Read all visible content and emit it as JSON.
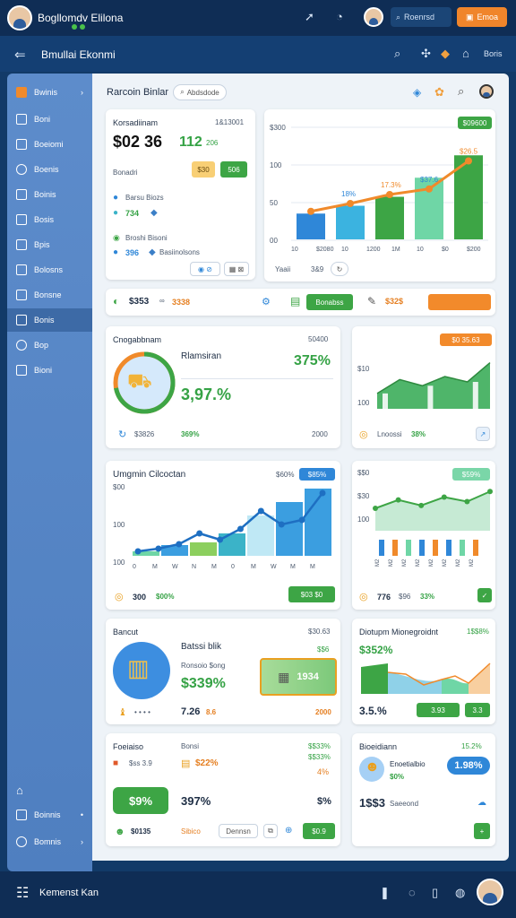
{
  "topbar": {
    "title": "Bogllomdv Elilona",
    "search_label": "Roenrsd",
    "orange_label": "Emoa"
  },
  "subbar": {
    "title": "Bmullai Ekonmi",
    "right_label": "Boris"
  },
  "sidebar": {
    "items": [
      {
        "label": "Bwinis"
      },
      {
        "label": "Boni"
      },
      {
        "label": "Boeiomi"
      },
      {
        "label": "Boenis"
      },
      {
        "label": "Boinis"
      },
      {
        "label": "Bosis"
      },
      {
        "label": "Bpis"
      },
      {
        "label": "Bolosns"
      },
      {
        "label": "Bonsne"
      },
      {
        "label": "Bonis"
      },
      {
        "label": "Bop"
      },
      {
        "label": "Bioni"
      }
    ],
    "bottom_items": [
      {
        "label": "Boinnis"
      },
      {
        "label": "Bomnis"
      }
    ]
  },
  "header": {
    "title": "Rarcoin Binlar",
    "chip": "Abdsdode"
  },
  "summary": {
    "title": "Korsadiinam",
    "right": "1&13001",
    "value1": "$02 36",
    "value2": "112",
    "value2_suffix": "206",
    "row_label": "Bonadri",
    "chip_orange": "$30",
    "btn_green": "506",
    "item1_label": "Barsu Biozs",
    "item1_val": "734",
    "item2_label": "Broshi Bisoni",
    "item3_val": "396",
    "item3_label": "Basiinolsons"
  },
  "main_chart": {
    "x_caption": "Yaaii",
    "x_caption2": "3&9",
    "points": [
      "18%",
      "17.3%",
      "$37.6",
      "$26.5"
    ],
    "right_label": "1700",
    "badge": "$09600"
  },
  "chart_data": [
    {
      "type": "bar",
      "title": "",
      "categories": [
        "1",
        "2",
        "3",
        "4",
        "5"
      ],
      "values": [
        23,
        30,
        38,
        55,
        75
      ],
      "line_values": [
        25,
        32,
        40,
        45,
        70
      ],
      "yticks": [
        "$300",
        "100",
        "50",
        "00"
      ],
      "xticks": [
        "10",
        "$2080",
        "10",
        "1200",
        "1M",
        "10",
        "$0",
        "$200"
      ],
      "ylim": [
        0,
        100
      ]
    },
    {
      "type": "area",
      "title": "",
      "values": [
        20,
        38,
        30,
        42,
        35,
        60
      ],
      "yticks": [
        "$10",
        "100",
        "$30"
      ]
    },
    {
      "type": "line",
      "title": "Umgmin Cilcoctan",
      "categories": [
        "0",
        "M",
        "W",
        "N",
        "M",
        "0",
        "M",
        "W",
        "M",
        "M"
      ],
      "values": [
        5,
        8,
        13,
        25,
        18,
        30,
        50,
        35,
        40,
        70
      ],
      "bar_values": [
        5,
        12,
        15,
        25,
        45,
        60,
        75
      ],
      "yticks": [
        "$00",
        "100",
        "100"
      ],
      "annotation": "$60%",
      "badge": "$85%"
    },
    {
      "type": "area",
      "title": "",
      "values": [
        40,
        55,
        45,
        60,
        52,
        70
      ],
      "yticks": [
        "$$0",
        "$30",
        "100"
      ],
      "badge": "$59%"
    }
  ],
  "action_bar": {
    "value": "$353",
    "chg": "3338",
    "btn_green": "Bonabss",
    "val2": "$32$",
    "btn_orange": ""
  },
  "progress_card": {
    "title": "Cnogabbnam",
    "right": "50400",
    "progress": 0.72,
    "name": "Rlamsiran",
    "pct": "375%",
    "value": "3,97.%",
    "footer1": "$3826",
    "footer2": "369%",
    "footer3": "2000"
  },
  "mini_card": {
    "badge": "$0 35.63",
    "footer1": "Lnoossi",
    "footer2": "38%"
  },
  "line_card": {
    "footer1": "300",
    "footer2": "$00%",
    "btn": "$03 $0"
  },
  "right_chart2": {
    "footer1": "776",
    "footer2": "$96",
    "footer3": "33%"
  },
  "bank_card": {
    "title": "Bancut",
    "right": "$30.63",
    "name": "Batssi blik",
    "sub": "Ronsoio $ong",
    "pct": "$339%",
    "highlight": "1934",
    "val1": "7.26",
    "val2": "8.6",
    "right_val": "$$6",
    "right_val2": "2000"
  },
  "mgmt_card": {
    "title": "Diotupm Mionegroidnt",
    "right": "1$$8%",
    "pct": "$352%",
    "value": "3.5.%",
    "btn1": "3.93",
    "btn2": "3.3"
  },
  "fin_card": {
    "title": "Foeiaiso",
    "title2": "Bonsi",
    "right": "$$33%",
    "r1": "$ss 3.9",
    "r1b": "$$33%",
    "r2": "$22%",
    "r2b": "4%",
    "btn": "$9%",
    "v1": "397%",
    "v2": "$%",
    "f1": "$0135",
    "f2": "Sibico",
    "f3": "Dennsn",
    "btn2": "$0.9"
  },
  "user_card": {
    "title": "Bioeidiann",
    "right": "15.2%",
    "name": "Enoetialbio",
    "pct": "$0%",
    "btn": "1.98%",
    "value": "1$$3",
    "sub": "Saeeond"
  },
  "bottombar": {
    "label": "Kemenst Kan"
  }
}
